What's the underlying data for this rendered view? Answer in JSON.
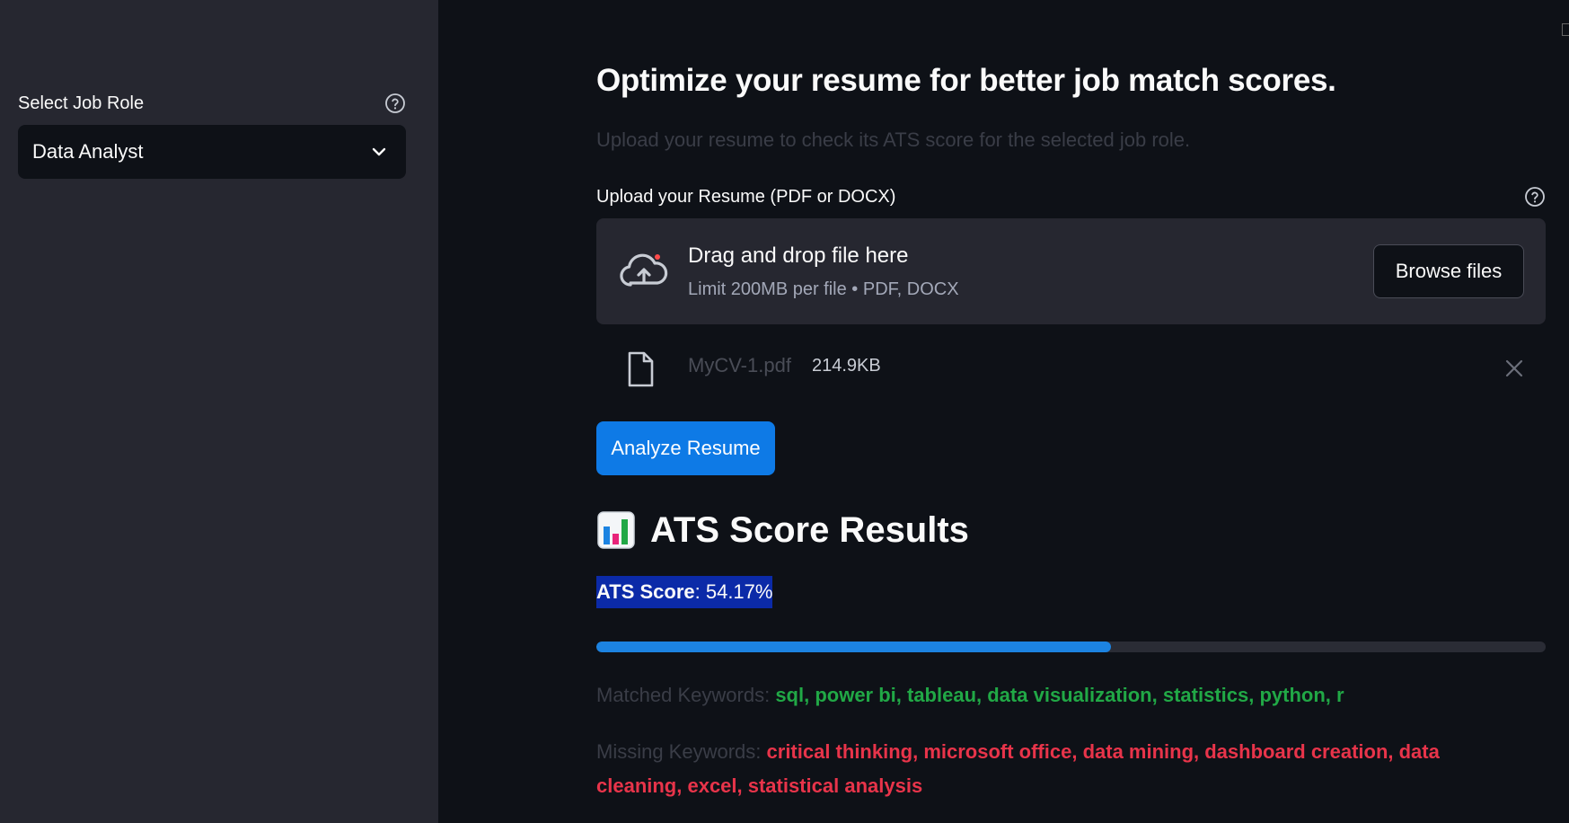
{
  "sidebar": {
    "label": "Select Job Role",
    "selected_role": "Data Analyst"
  },
  "main": {
    "title": "Optimize your resume for better job match scores.",
    "subtitle": "Upload your resume to check its ATS score for the selected job role.",
    "upload_label": "Upload your Resume (PDF or DOCX)",
    "dropzone": {
      "title": "Drag and drop file here",
      "limit": "Limit 200MB per file • PDF, DOCX",
      "browse_label": "Browse files"
    },
    "file": {
      "name": "MyCV-1.pdf",
      "size": "214.9KB"
    },
    "analyze_label": "Analyze Resume",
    "results_title": "ATS Score Results",
    "score_label": "ATS Score",
    "score_value": ": 54.17%",
    "score_fraction": 0.5417,
    "matched_label": "Matched Keywords: ",
    "matched_keywords": "sql, power bi, tableau, data visualization, statistics, python, r",
    "missing_label": "Missing Keywords: ",
    "missing_keywords": "critical thinking, microsoft office, data mining, dashboard creation, data cleaning, excel, statistical analysis"
  },
  "colors": {
    "accent": "#0e7ae6",
    "progress": "#1c83e1",
    "matched": "#21a846",
    "missing": "#e8344a"
  }
}
